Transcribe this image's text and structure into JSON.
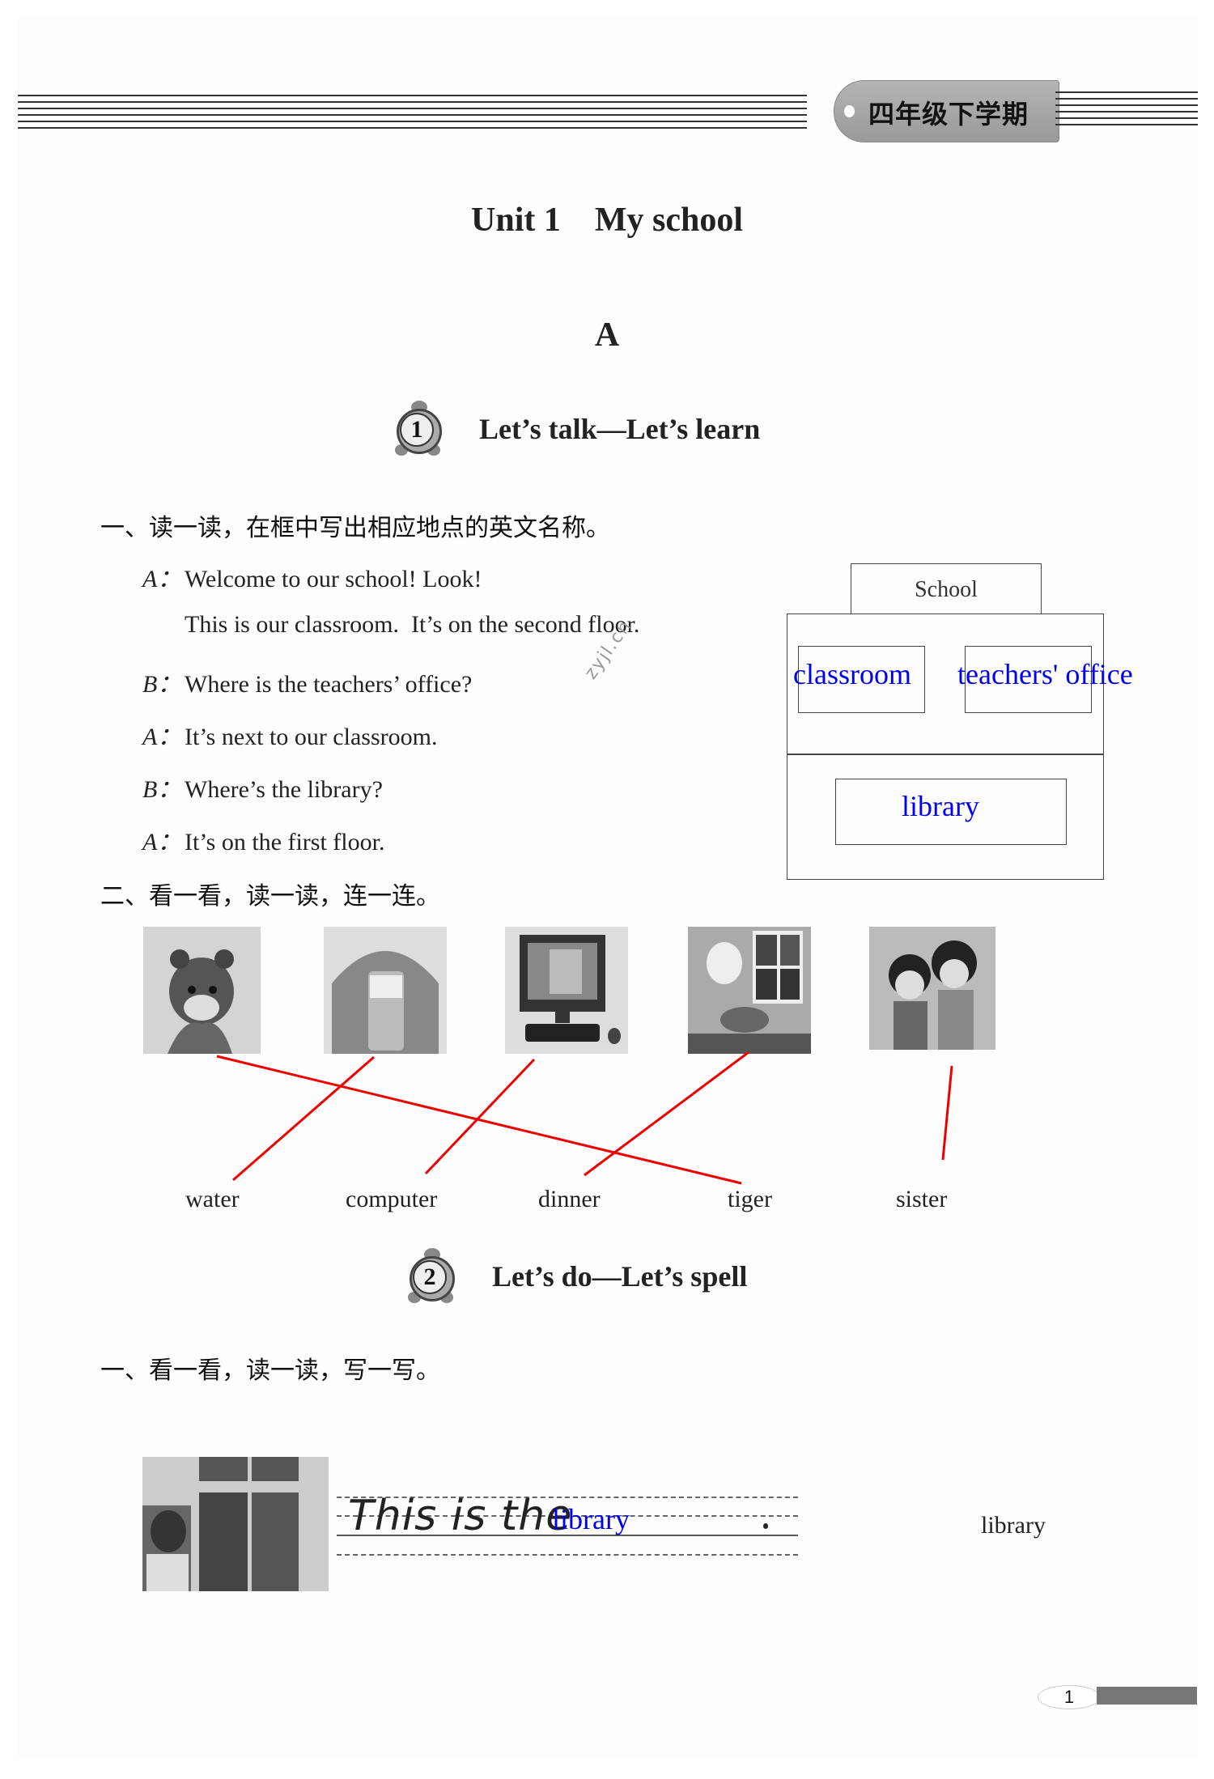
{
  "header": {
    "grade_tag": "四年级下学期"
  },
  "unit_title": "Unit 1    My school",
  "part_label": "A",
  "section1": {
    "number": "1",
    "title": "Let’s talk—Let’s learn",
    "exercise1": {
      "instruction": "一、读一读，在框中写出相应地点的英文名称。",
      "dialogue": [
        {
          "speaker": "A：",
          "text": "Welcome to our school! Look!"
        },
        {
          "speaker": "",
          "text": "This is our classroom.  It’s on the second floor."
        },
        {
          "speaker": "B：",
          "text": "Where is the teachers’ office?"
        },
        {
          "speaker": "A：",
          "text": "It’s next to our classroom."
        },
        {
          "speaker": "B：",
          "text": "Where’s the library?"
        },
        {
          "speaker": "A：",
          "text": "It’s on the first floor."
        }
      ],
      "diagram": {
        "building_label": "School",
        "second_floor_answers": [
          "classroom",
          "teachers' office"
        ],
        "first_floor_answer": "library",
        "answer_color": "#0000ee"
      }
    },
    "exercise2": {
      "instruction": "二、看一看，读一读，连一连。",
      "pictures": [
        "tiger",
        "water",
        "computer",
        "dinner",
        "sister"
      ],
      "words": [
        "water",
        "computer",
        "dinner",
        "tiger",
        "sister"
      ],
      "matches": [
        {
          "picture": "tiger",
          "word": "tiger"
        },
        {
          "picture": "water",
          "word": "water"
        },
        {
          "picture": "computer",
          "word": "computer"
        },
        {
          "picture": "dinner",
          "word": "dinner"
        },
        {
          "picture": "sister",
          "word": "sister"
        }
      ],
      "line_color": "#ee0000"
    }
  },
  "section2": {
    "number": "2",
    "title": "Let’s do—Let’s spell",
    "exercise1": {
      "instruction": "一、看一看，读一读，写一写。",
      "sentence_prefix": "This is the",
      "answer": "library",
      "hint_word": "library"
    }
  },
  "watermark": "zyjl.cn",
  "page_number": "1"
}
